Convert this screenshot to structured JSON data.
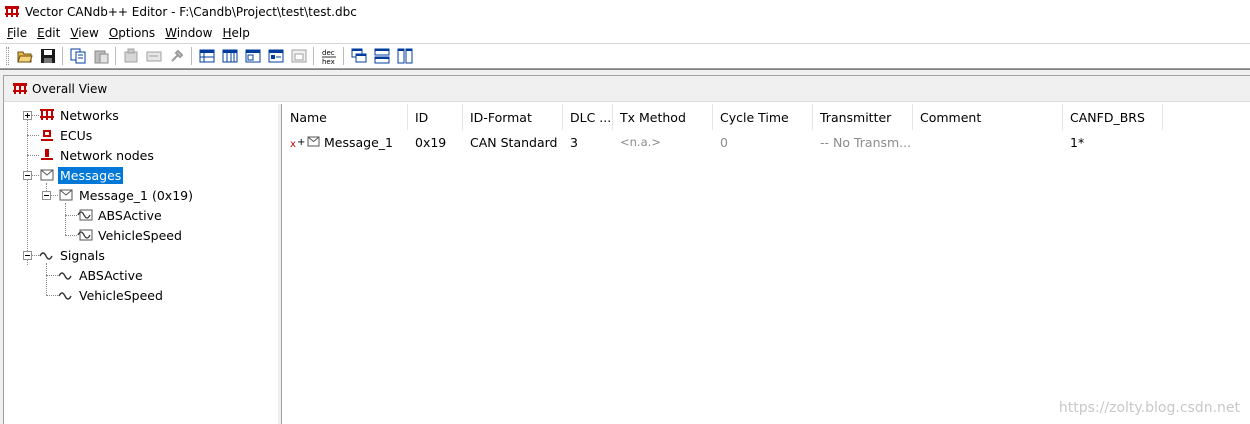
{
  "window": {
    "title": "Vector CANdb++ Editor - F:\\Candb\\Project\\test\\test.dbc"
  },
  "menu": [
    {
      "key": "F",
      "rest": "ile"
    },
    {
      "key": "E",
      "rest": "dit"
    },
    {
      "key": "V",
      "rest": "iew"
    },
    {
      "key": "O",
      "rest": "ptions"
    },
    {
      "key": "W",
      "rest": "indow"
    },
    {
      "key": "H",
      "rest": "elp"
    }
  ],
  "toolbar": {
    "icons": [
      "open-folder-icon",
      "save-icon",
      "copy-icon",
      "paste-icon",
      "properties-icon",
      "edit-icon",
      "tools-icon",
      "table-view-icon",
      "grid-icon",
      "columns-icon",
      "list-icon",
      "print-icon",
      "dec-hex-icon",
      "cascade-icon",
      "tile-horizontal-icon",
      "tile-vertical-icon"
    ],
    "dec_hex_top": "dec",
    "dec_hex_bottom": "hex"
  },
  "overall_view": {
    "title": "Overall View"
  },
  "tree": {
    "networks": "Networks",
    "ecus": "ECUs",
    "network_nodes": "Network nodes",
    "messages": "Messages",
    "message_1": "Message_1 (0x19)",
    "msg_signal_1": "ABSActive",
    "msg_signal_2": "VehicleSpeed",
    "signals": "Signals",
    "signal_1": "ABSActive",
    "signal_2": "VehicleSpeed"
  },
  "table": {
    "columns": [
      "Name",
      "ID",
      "ID-Format",
      "DLC ...",
      "Tx Method",
      "Cycle Time",
      "Transmitter",
      "Comment",
      "CANFD_BRS"
    ],
    "row": {
      "name": "Message_1",
      "id": "0x19",
      "id_format": "CAN Standard",
      "dlc": "3",
      "tx_method": "<n.a.>",
      "cycle_time": "0",
      "transmitter": "-- No Transm...",
      "comment": "",
      "canfd_brs": "1*"
    }
  },
  "watermark": "https://zolty.blog.csdn.net",
  "colors": {
    "selection": "#0078d7",
    "node_red": "#c00000",
    "toolbar_blue": "#003c9e"
  }
}
